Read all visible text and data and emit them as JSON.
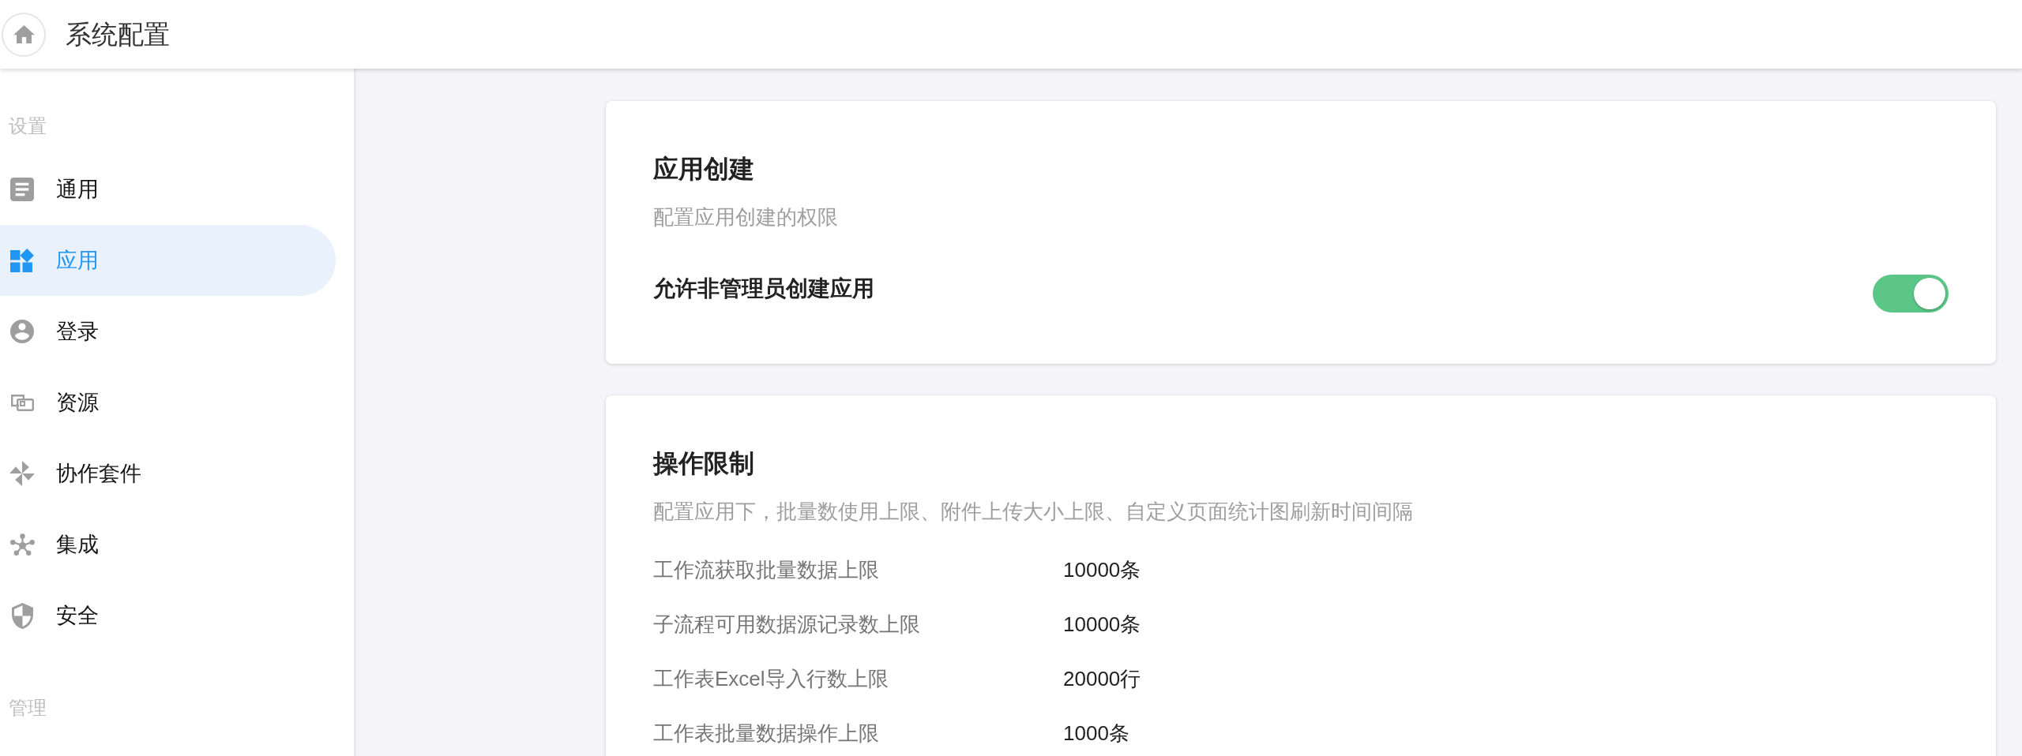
{
  "header": {
    "title": "系统配置"
  },
  "sidebar": {
    "sections": [
      {
        "label": "设置",
        "items": [
          {
            "label": "通用",
            "selected": false
          },
          {
            "label": "应用",
            "selected": true
          },
          {
            "label": "登录",
            "selected": false
          },
          {
            "label": "资源",
            "selected": false
          },
          {
            "label": "协作套件",
            "selected": false
          },
          {
            "label": "集成",
            "selected": false
          },
          {
            "label": "安全",
            "selected": false
          }
        ]
      },
      {
        "label": "管理"
      }
    ]
  },
  "cards": [
    {
      "title": "应用创建",
      "description": "配置应用创建的权限",
      "toggles": [
        {
          "label": "允许非管理员创建应用",
          "on": true
        }
      ]
    },
    {
      "title": "操作限制",
      "description": "配置应用下，批量数使用上限、附件上传大小上限、自定义页面统计图刷新时间间隔",
      "limits": [
        {
          "label": "工作流获取批量数据上限",
          "value": "10000条"
        },
        {
          "label": "子流程可用数据源记录数上限",
          "value": "10000条"
        },
        {
          "label": "工作表Excel导入行数上限",
          "value": "20000行"
        },
        {
          "label": "工作表批量数据操作上限",
          "value": "1000条"
        }
      ]
    }
  ]
}
